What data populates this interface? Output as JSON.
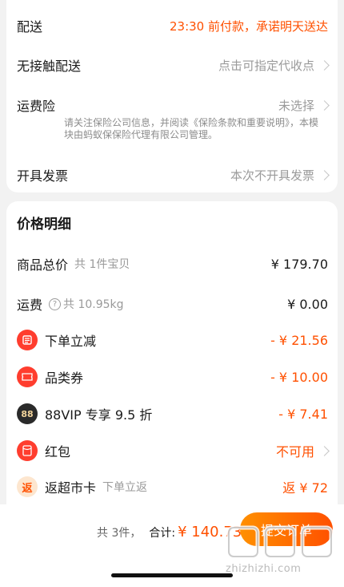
{
  "delivery": {
    "shipping_label": "配送",
    "shipping_value": "23:30 前付款，承诺明天送达",
    "contactless_label": "无接触配送",
    "contactless_value": "点击可指定代收点",
    "insurance_label": "运费险",
    "insurance_value": "未选择",
    "insurance_notice": "请关注保险公司信息，并阅读《保险条款和重要说明》，本模块由蚂蚁保保险代理有限公司管理。",
    "invoice_label": "开具发票",
    "invoice_value": "本次不开具发票"
  },
  "price_detail": {
    "title": "价格明细",
    "goods_total_label": "商品总价",
    "goods_total_sub": "共 1件宝贝",
    "goods_total_value": "¥ 179.70",
    "freight_label": "运费",
    "freight_sub": "共 10.95kg",
    "freight_value": "¥ 0.00",
    "instant_discount_label": "下单立减",
    "instant_discount_value": "- ¥ 21.56",
    "category_coupon_label": "品类券",
    "category_coupon_value": "- ¥ 10.00",
    "vip_label": "88VIP 专享 9.5 折",
    "vip_badge": "88",
    "vip_value": "- ¥ 7.41",
    "red_packet_label": "红包",
    "red_packet_value": "不可用",
    "supermarket_label": "返超市卡",
    "supermarket_sub": "下单立返",
    "supermarket_badge": "返",
    "supermarket_value": "返 ¥ 72"
  },
  "footer": {
    "count": "共 3件，",
    "total_label": "合计:",
    "total_amount": "¥ 140.73",
    "submit_label": "提交订单"
  },
  "watermark": {
    "text": "zhizhizhi.com"
  },
  "colors": {
    "accent": "#ff5000",
    "background": "#f2f2f2"
  }
}
